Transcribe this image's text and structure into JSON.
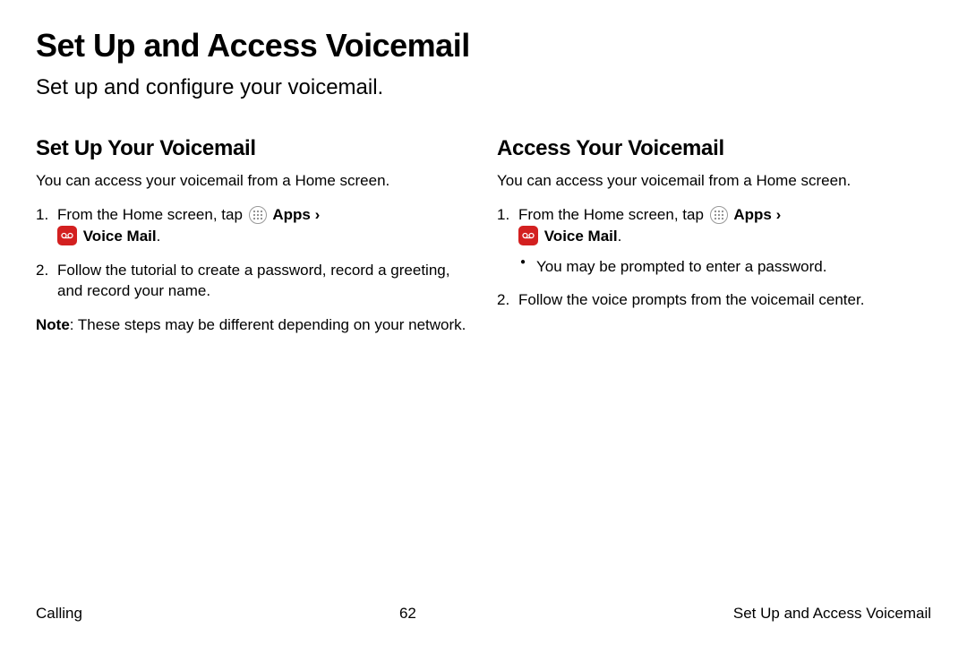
{
  "title": "Set Up and Access Voicemail",
  "subtitle": "Set up and configure your voicemail.",
  "left": {
    "heading": "Set Up Your Voicemail",
    "intro": "You can access your voicemail from a Home screen.",
    "step1_prefix": "From the Home screen, tap ",
    "apps_label": "Apps",
    "voicemail_label": "Voice Mail",
    "step2": "Follow the tutorial to create a password, record a greeting, and record your name.",
    "note_label": "Note",
    "note_text": ": These steps may be different depending on your network."
  },
  "right": {
    "heading": "Access Your Voicemail",
    "intro": "You can access your voicemail from a Home screen.",
    "step1_prefix": "From the Home screen, tap ",
    "apps_label": "Apps",
    "voicemail_label": "Voice Mail",
    "bullet": "You may be prompted to enter a password.",
    "step2": "Follow the voice prompts from the voicemail center."
  },
  "footer": {
    "left": "Calling",
    "center": "62",
    "right": "Set Up and Access Voicemail"
  }
}
